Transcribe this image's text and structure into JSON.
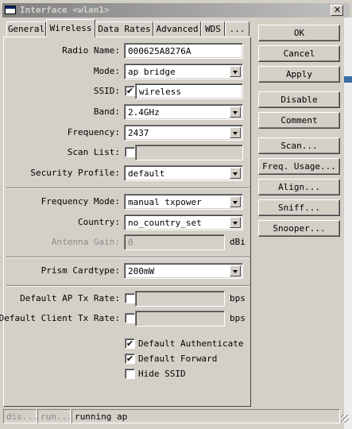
{
  "window": {
    "title": "Interface <wlan1>"
  },
  "tabs": [
    "General",
    "Wireless",
    "Data Rates",
    "Advanced",
    "WDS",
    "..."
  ],
  "active_tab": "Wireless",
  "form": {
    "radio_name": {
      "label": "Radio Name:",
      "value": "000625A8276A"
    },
    "mode": {
      "label": "Mode:",
      "value": "ap bridge"
    },
    "ssid": {
      "label": "SSID:",
      "value": "wireless",
      "checked": true,
      "check_mark": "✔"
    },
    "band": {
      "label": "Band:",
      "value": "2.4GHz"
    },
    "frequency": {
      "label": "Frequency:",
      "value": "2437"
    },
    "scan_list": {
      "label": "Scan List:",
      "value": ""
    },
    "security_profile": {
      "label": "Security Profile:",
      "value": "default"
    },
    "frequency_mode": {
      "label": "Frequency Mode:",
      "value": "manual txpower"
    },
    "country": {
      "label": "Country:",
      "value": "no_country_set"
    },
    "antenna_gain": {
      "label": "Antenna Gain:",
      "value": "0",
      "unit": "dBi"
    },
    "prism_cardtype": {
      "label": "Prism Cardtype:",
      "value": "200mW"
    },
    "default_ap_tx_rate": {
      "label": "Default AP Tx Rate:",
      "unit": "bps"
    },
    "default_client_tx_rate": {
      "label": "Default Client Tx Rate:",
      "unit": "bps"
    }
  },
  "checkboxes": {
    "default_authenticate": {
      "label": "Default Authenticate",
      "checked": true,
      "mark": "✔"
    },
    "default_forward": {
      "label": "Default Forward",
      "checked": true,
      "mark": "✔"
    },
    "hide_ssid": {
      "label": "Hide SSID",
      "checked": false
    }
  },
  "buttons": {
    "ok": "OK",
    "cancel": "Cancel",
    "apply": "Apply",
    "disable": "Disable",
    "comment": "Comment",
    "scan": "Scan...",
    "freq_usage": "Freq. Usage...",
    "align": "Align...",
    "sniff": "Sniff...",
    "snooper": "Snooper..."
  },
  "status_bar": {
    "seg1": "dis...",
    "seg2": "run...",
    "seg3": "running ap"
  },
  "colors": {
    "titlebar_start": "#808080",
    "titlebar_end": "#c0c0c0",
    "face": "#d4d0c8",
    "accent_blue": "#0a246a"
  }
}
